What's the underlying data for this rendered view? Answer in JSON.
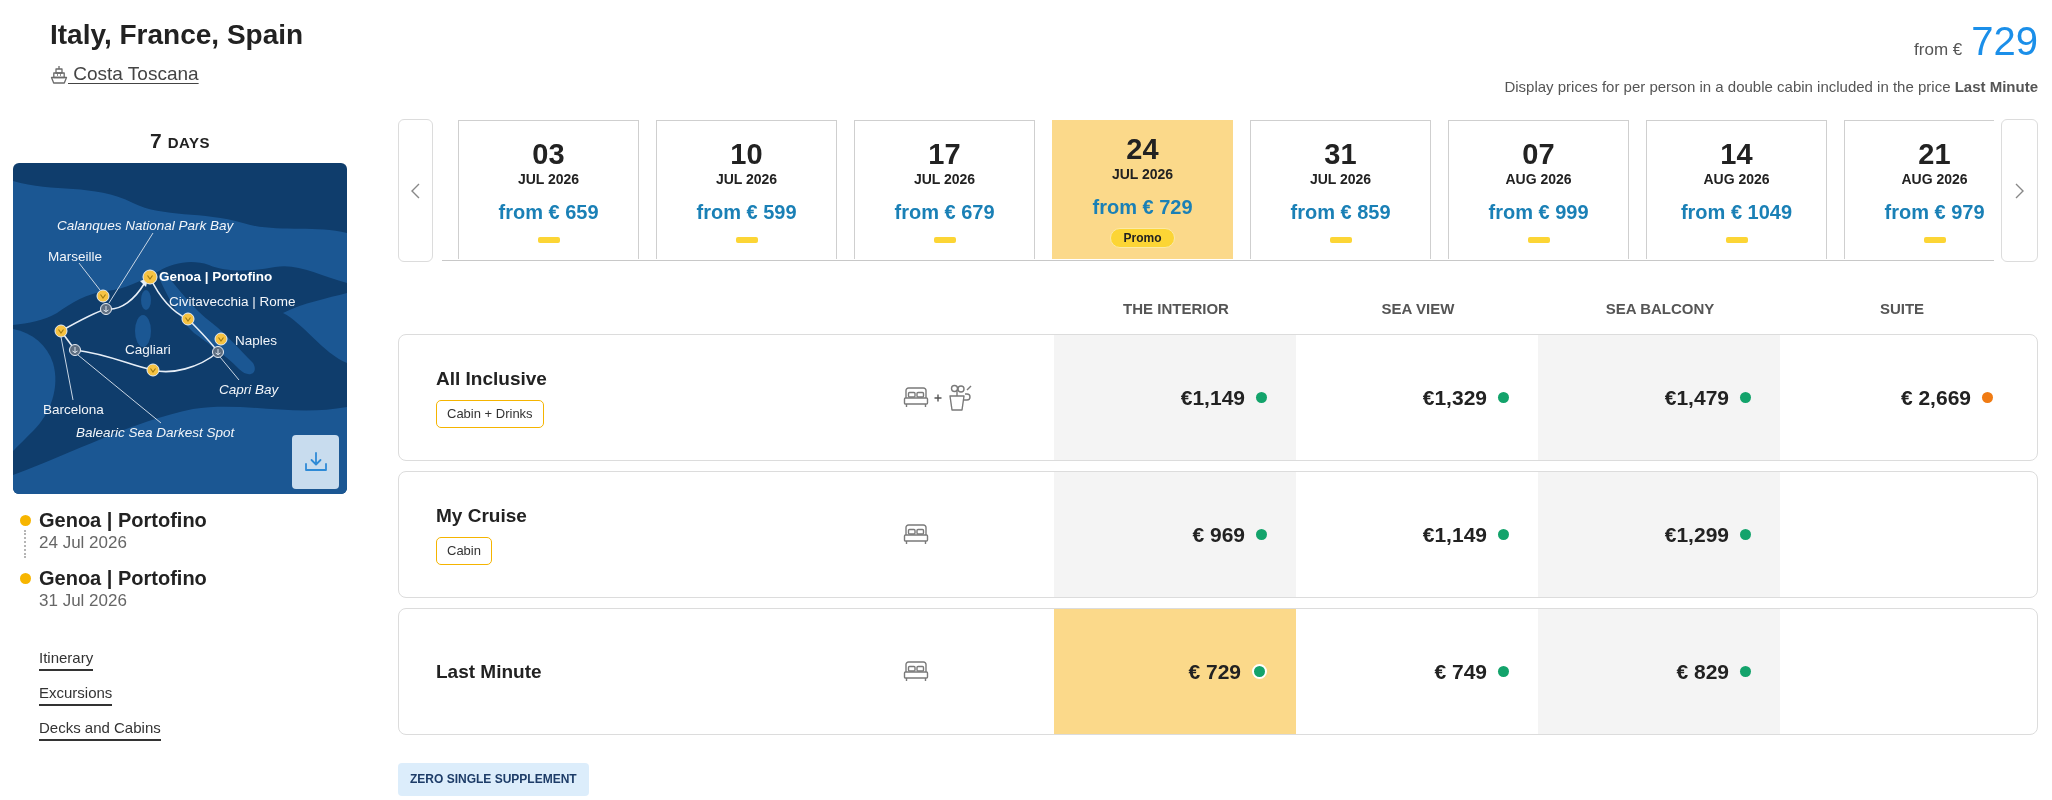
{
  "header": {
    "title": "Italy, France, Spain",
    "ship": "Costa Toscana",
    "price_prefix": "from €",
    "price": "729",
    "note": "Display prices for per person in a double cabin included in the price **Last Minute**"
  },
  "duration": {
    "number": "7",
    "unit": "DAYS"
  },
  "map": {
    "stops": [
      {
        "name": "Calanques National Park Bay",
        "kind": "scenic"
      },
      {
        "name": "Marseille",
        "kind": "port"
      },
      {
        "name": "Genoa | Portofino",
        "kind": "embark"
      },
      {
        "name": "Civitavecchia | Rome",
        "kind": "port"
      },
      {
        "name": "Naples",
        "kind": "port"
      },
      {
        "name": "Cagliari",
        "kind": "port"
      },
      {
        "name": "Capri Bay",
        "kind": "scenic"
      },
      {
        "name": "Barcelona",
        "kind": "port"
      },
      {
        "name": "Balearic Sea Darkest Spot",
        "kind": "scenic"
      }
    ]
  },
  "itinerary": [
    {
      "port": "Genoa | Portofino",
      "date": "24 Jul 2026"
    },
    {
      "port": "Genoa | Portofino",
      "date": "31 Jul 2026"
    }
  ],
  "links": [
    "Itinerary",
    "Excursions",
    "Decks and Cabins"
  ],
  "dates": [
    {
      "day": "03",
      "month": "JUL 2026",
      "price": "from € 659",
      "selected": false
    },
    {
      "day": "10",
      "month": "JUL 2026",
      "price": "from € 599",
      "selected": false
    },
    {
      "day": "17",
      "month": "JUL 2026",
      "price": "from € 679",
      "selected": false
    },
    {
      "day": "24",
      "month": "JUL 2026",
      "price": "from € 729",
      "selected": true,
      "badge": "Promo"
    },
    {
      "day": "31",
      "month": "JUL 2026",
      "price": "from € 859",
      "selected": false
    },
    {
      "day": "07",
      "month": "AUG 2026",
      "price": "from € 999",
      "selected": false
    },
    {
      "day": "14",
      "month": "AUG 2026",
      "price": "from € 1049",
      "selected": false
    },
    {
      "day": "21",
      "month": "AUG 2026",
      "price": "from € 979",
      "selected": false
    }
  ],
  "cabin_columns": [
    "THE INTERIOR",
    "SEA VIEW",
    "SEA BALCONY",
    "SUITE"
  ],
  "fares": [
    {
      "name": "All Inclusive",
      "tag": "Cabin + Drinks",
      "drinks": true,
      "prices": [
        {
          "value": "€1,149",
          "color": "#13a36b",
          "selected": false
        },
        {
          "value": "€1,329",
          "color": "#13a36b",
          "selected": false
        },
        {
          "value": "€1,479",
          "color": "#13a36b",
          "selected": false
        },
        {
          "value": "€ 2,669",
          "color": "#f07b13",
          "selected": false
        }
      ]
    },
    {
      "name": "My Cruise",
      "tag": "Cabin",
      "drinks": false,
      "prices": [
        {
          "value": "€ 969",
          "color": "#13a36b",
          "selected": false
        },
        {
          "value": "€1,149",
          "color": "#13a36b",
          "selected": false
        },
        {
          "value": "€1,299",
          "color": "#13a36b",
          "selected": false
        }
      ]
    },
    {
      "name": "Last Minute",
      "drinks": false,
      "prices": [
        {
          "value": "€ 729",
          "color": "#13a36b",
          "selected": true
        },
        {
          "value": "€ 749",
          "color": "#13a36b",
          "selected": false
        },
        {
          "value": "€ 829",
          "color": "#13a36b",
          "selected": false
        }
      ]
    }
  ],
  "supplement_badge": "ZERO SINGLE SUPPLEMENT"
}
